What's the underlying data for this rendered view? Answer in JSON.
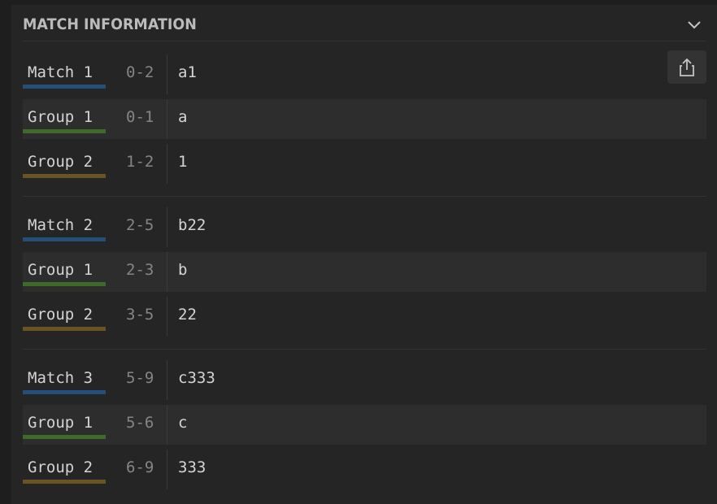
{
  "panel": {
    "title": "MATCH INFORMATION"
  },
  "colors": {
    "match_bar": "#264f78",
    "group1_bar": "#3f6b2a",
    "group2_bar": "#6b5424",
    "text": "#d4d4d4",
    "range_text": "#858585",
    "background": "#252526"
  },
  "icons": {
    "collapse": "chevron-down-icon",
    "share": "share-icon"
  },
  "matches": [
    {
      "rows": [
        {
          "label": "Match 1",
          "range": "0-2",
          "value": "a1",
          "kind": "match"
        },
        {
          "label": "Group 1",
          "range": "0-1",
          "value": "a",
          "kind": "group1"
        },
        {
          "label": "Group 2",
          "range": "1-2",
          "value": "1",
          "kind": "group2"
        }
      ]
    },
    {
      "rows": [
        {
          "label": "Match 2",
          "range": "2-5",
          "value": "b22",
          "kind": "match"
        },
        {
          "label": "Group 1",
          "range": "2-3",
          "value": "b",
          "kind": "group1"
        },
        {
          "label": "Group 2",
          "range": "3-5",
          "value": "22",
          "kind": "group2"
        }
      ]
    },
    {
      "rows": [
        {
          "label": "Match 3",
          "range": "5-9",
          "value": "c333",
          "kind": "match"
        },
        {
          "label": "Group 1",
          "range": "5-6",
          "value": "c",
          "kind": "group1"
        },
        {
          "label": "Group 2",
          "range": "6-9",
          "value": "333",
          "kind": "group2"
        }
      ]
    }
  ]
}
